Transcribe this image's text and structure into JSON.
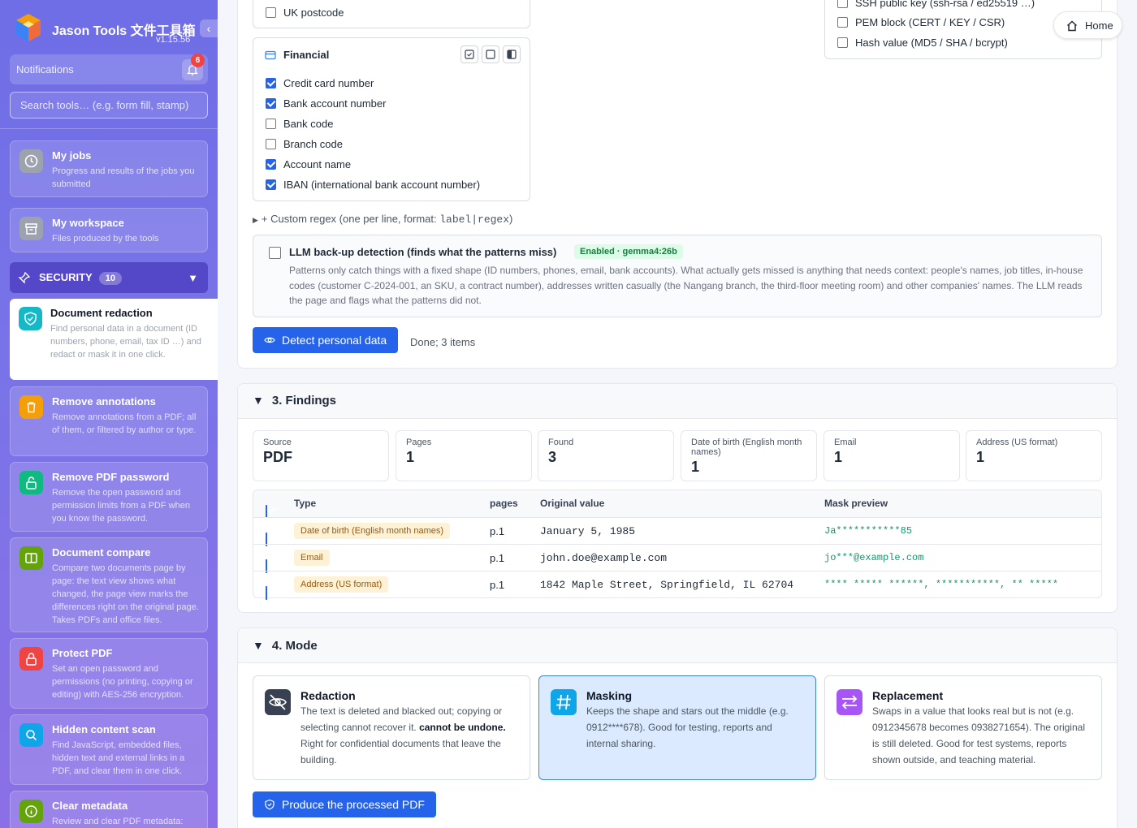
{
  "app": {
    "title": "Jason Tools 文件工具箱",
    "version": "v1.15.56"
  },
  "sidebar": {
    "notifications_label": "Notifications",
    "notifications_count": "6",
    "search_placeholder": "Search tools… (e.g. form fill, stamp)",
    "pinned": [
      {
        "title": "My jobs",
        "desc": "Progress and results of the jobs you submitted",
        "icon": "clock-icon"
      },
      {
        "title": "My workspace",
        "desc": "Files produced by the tools",
        "icon": "archive-icon"
      }
    ],
    "section": {
      "label": "SECURITY",
      "count": "10"
    },
    "tools": [
      {
        "title": "Document redaction",
        "desc": "Find personal data in a document (ID numbers, phone, email, tax ID …) and redact or mask it in one click.",
        "icon": "shield-check-icon",
        "color": "#14b8c6"
      },
      {
        "title": "Remove annotations",
        "desc": "Remove annotations from a PDF; all of them, or filtered by author or type.",
        "icon": "trash-icon",
        "color": "#f59e0b"
      },
      {
        "title": "Remove PDF password",
        "desc": "Remove the open password and permission limits from a PDF when you know the password.",
        "icon": "unlock-icon",
        "color": "#10b981"
      },
      {
        "title": "Document compare",
        "desc": "Compare two documents page by page: the text view shows what changed, the page view marks the differences right on the original page. Takes PDFs and office files.",
        "icon": "compare-icon",
        "color": "#65a30d"
      },
      {
        "title": "Protect PDF",
        "desc": "Set an open password and permissions (no printing, copying or editing) with AES-256 encryption.",
        "icon": "lock-icon",
        "color": "#ef4444"
      },
      {
        "title": "Hidden content scan",
        "desc": "Find JavaScript, embedded files, hidden text and external links in a PDF, and clear them in one click.",
        "icon": "search-icon",
        "color": "#0ea5e9"
      },
      {
        "title": "Clear metadata",
        "desc": "Review and clear PDF metadata:",
        "icon": "info-icon",
        "color": "#65a30d"
      }
    ]
  },
  "header": {
    "home_label": "Home"
  },
  "detect": {
    "top_left_item": "UK postcode",
    "right_items": [
      {
        "label": "SSH public key (ssh-rsa / ed25519 …)",
        "checked": false
      },
      {
        "label": "PEM block (CERT / KEY / CSR)",
        "checked": false
      },
      {
        "label": "Hash value (MD5 / SHA / bcrypt)",
        "checked": false
      }
    ],
    "financial": {
      "title": "Financial",
      "items": [
        {
          "label": "Credit card number",
          "checked": true
        },
        {
          "label": "Bank account number",
          "checked": true
        },
        {
          "label": "Bank code",
          "checked": false
        },
        {
          "label": "Branch code",
          "checked": false
        },
        {
          "label": "Account name",
          "checked": true
        },
        {
          "label": "IBAN (international bank account number)",
          "checked": true
        }
      ]
    },
    "custom_regex_prefix": "+ Custom regex (one per line, format: ",
    "custom_regex_code": "label|regex",
    "custom_regex_suffix": ")",
    "llm": {
      "title": "LLM back-up detection (finds what the patterns miss)",
      "badge": "Enabled · gemma4:26b",
      "desc": "Patterns only catch things with a fixed shape (ID numbers, phones, email, bank accounts). What actually gets missed is anything that needs context: people's names, job titles, in-house codes (customer C-2024-001, an SKU, a contract number), addresses written casually (the Nangang branch, the third-floor meeting room) and other companies' names. The LLM reads the page and flags what the patterns did not."
    },
    "button_label": "Detect personal data",
    "status": "Done; 3 items"
  },
  "findings": {
    "title": "3. Findings",
    "stats": [
      {
        "label": "Source",
        "value": "PDF"
      },
      {
        "label": "Pages",
        "value": "1"
      },
      {
        "label": "Found",
        "value": "3"
      },
      {
        "label": "Date of birth (English month names)",
        "value": "1"
      },
      {
        "label": "Email",
        "value": "1"
      },
      {
        "label": "Address (US format)",
        "value": "1"
      }
    ],
    "columns": {
      "type": "Type",
      "pages": "pages",
      "original": "Original value",
      "mask": "Mask preview"
    },
    "rows": [
      {
        "type": "Date of birth (English month names)",
        "page": "p.1",
        "original": "January 5, 1985",
        "mask": "Ja***********85"
      },
      {
        "type": "Email",
        "page": "p.1",
        "original": "john.doe@example.com",
        "mask": "jo***@example.com"
      },
      {
        "type": "Address (US format)",
        "page": "p.1",
        "original": "1842 Maple Street, Springfield, IL 62704",
        "mask": "**** ***** ******, ***********, ** *****"
      }
    ]
  },
  "mode": {
    "title": "4. Mode",
    "options": [
      {
        "title": "Redaction",
        "desc_before": "The text is deleted and blacked out; copying or selecting cannot recover it. ",
        "desc_bold": "cannot be undone.",
        "desc_after": " Right for confidential documents that leave the building.",
        "icon": "eye-off-icon"
      },
      {
        "title": "Masking",
        "desc": "Keeps the shape and stars out the middle (e.g. 0912****678). Good for testing, reports and internal sharing.",
        "icon": "hash-icon",
        "selected": true
      },
      {
        "title": "Replacement",
        "desc": "Swaps in a value that looks real but is not (e.g. 0912345678 becomes 0938271654). The original is still deleted. Good for test systems, reports shown outside, and teaching material.",
        "icon": "swap-icon"
      }
    ],
    "button_label": "Produce the processed PDF"
  },
  "colors": {
    "primary": "#2563eb",
    "sidebar": "#7a73e8",
    "mask_text": "#0f9b6a",
    "tag_bg": "#fdf1d6"
  }
}
